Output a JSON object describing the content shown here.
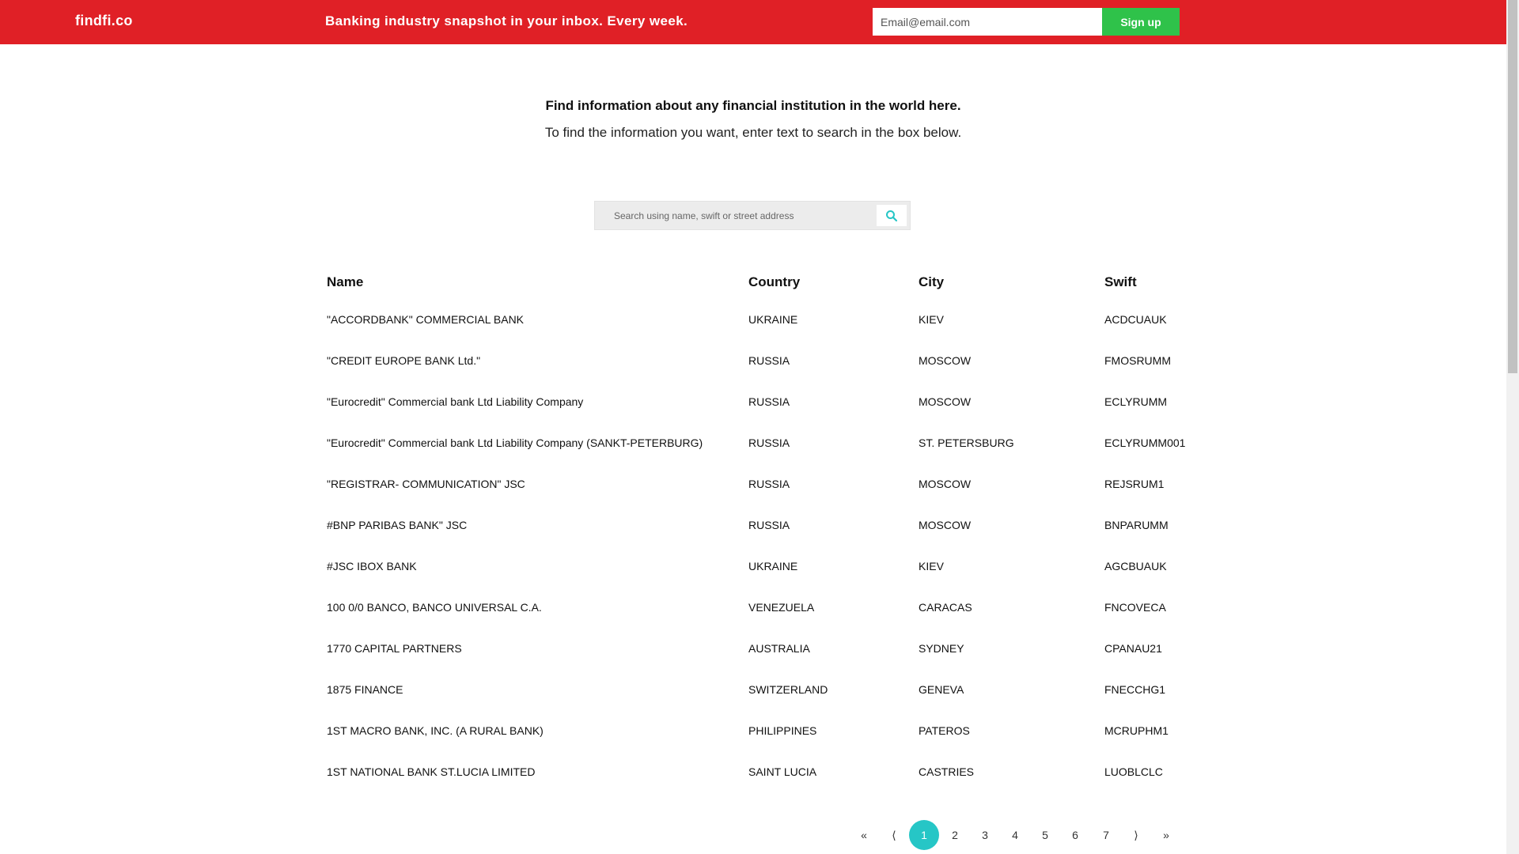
{
  "header": {
    "brand": "findfi.co",
    "tagline": "Banking industry snapshot in your inbox. Every week.",
    "email_placeholder": "Email@email.com",
    "signup_label": "Sign up"
  },
  "intro": {
    "title": "Find information about any financial institution in the world here.",
    "subtitle": "To find the information you want, enter text to search in the box below."
  },
  "search": {
    "placeholder": "Search using name, swift or street address",
    "icon": "search-icon"
  },
  "table": {
    "columns": [
      "Name",
      "Country",
      "City",
      "Swift"
    ],
    "rows": [
      [
        "\"ACCORDBANK\" COMMERCIAL BANK",
        "UKRAINE",
        "KIEV",
        "ACDCUAUK"
      ],
      [
        "\"CREDIT EUROPE BANK Ltd.\"",
        "RUSSIA",
        "MOSCOW",
        "FMOSRUMM"
      ],
      [
        "\"Eurocredit\" Commercial bank Ltd Liability Company",
        "RUSSIA",
        "MOSCOW",
        "ECLYRUMM"
      ],
      [
        "\"Eurocredit\" Commercial bank Ltd Liability Company (SANKT-PETERBURG)",
        "RUSSIA",
        "ST. PETERSBURG",
        "ECLYRUMM001"
      ],
      [
        "\"REGISTRAR- COMMUNICATION\" JSC",
        "RUSSIA",
        "MOSCOW",
        "REJSRUM1"
      ],
      [
        "#BNP PARIBAS BANK\" JSC",
        "RUSSIA",
        "MOSCOW",
        "BNPARUMM"
      ],
      [
        "#JSC IBOX BANK",
        "UKRAINE",
        "KIEV",
        "AGCBUAUK"
      ],
      [
        "100 0/0 BANCO, BANCO UNIVERSAL C.A.",
        "VENEZUELA",
        "CARACAS",
        "FNCOVECA"
      ],
      [
        "1770 CAPITAL PARTNERS",
        "AUSTRALIA",
        "SYDNEY",
        "CPANAU21"
      ],
      [
        "1875 FINANCE",
        "SWITZERLAND",
        "GENEVA",
        "FNECCHG1"
      ],
      [
        "1ST MACRO BANK, INC. (A RURAL BANK)",
        "PHILIPPINES",
        "PATEROS",
        "MCRUPHM1"
      ],
      [
        "1ST NATIONAL BANK ST.LUCIA LIMITED",
        "SAINT LUCIA",
        "CASTRIES",
        "LUOBLCLC"
      ]
    ]
  },
  "pagination": {
    "first": "«",
    "prev": "⟨",
    "pages": [
      "1",
      "2",
      "3",
      "4",
      "5",
      "6",
      "7"
    ],
    "current": "1",
    "next": "⟩",
    "last": "»"
  },
  "colors": {
    "header_bg": "#e02026",
    "signup_bg": "#2fc24a",
    "accent": "#26c6c6"
  }
}
